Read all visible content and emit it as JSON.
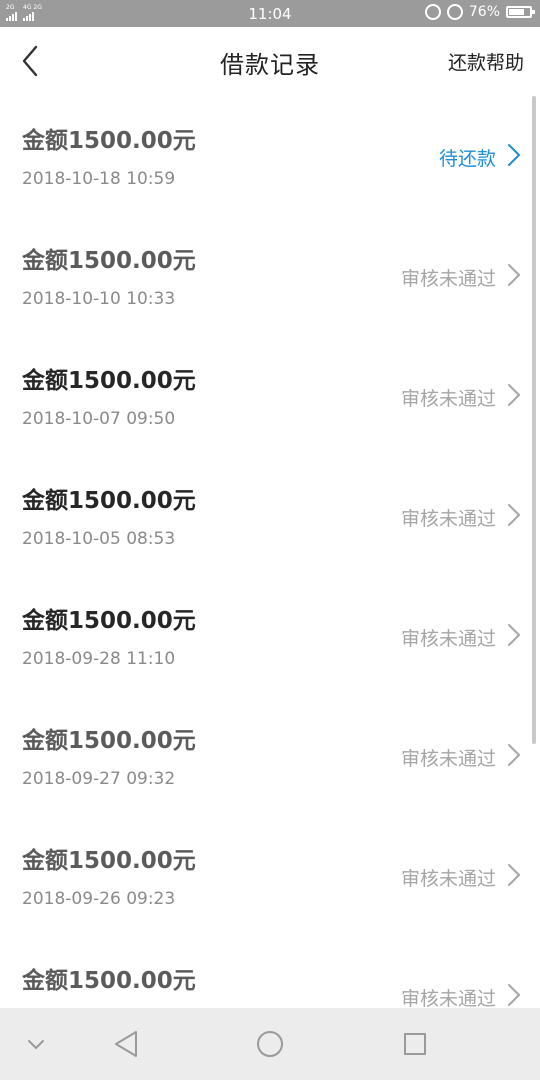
{
  "status_bar": {
    "left_sim1": "2G",
    "left_sim2": "4G 2G",
    "time": "11:04",
    "battery_percent": "76%",
    "battery_level": 0.76
  },
  "header": {
    "title": "借款记录",
    "help": "还款帮助"
  },
  "records": [
    {
      "amount": "金额1500.00元",
      "date": "2018-10-18 10:59",
      "status": "待还款",
      "status_type": "pending"
    },
    {
      "amount": "金额1500.00元",
      "date": "2018-10-10 10:33",
      "status": "审核未通过",
      "status_type": "rejected"
    },
    {
      "amount": "金额1500.00元",
      "date": "2018-10-07 09:50",
      "status": "审核未通过",
      "status_type": "rejected"
    },
    {
      "amount": "金额1500.00元",
      "date": "2018-10-05 08:53",
      "status": "审核未通过",
      "status_type": "rejected"
    },
    {
      "amount": "金额1500.00元",
      "date": "2018-09-28 11:10",
      "status": "审核未通过",
      "status_type": "rejected"
    },
    {
      "amount": "金额1500.00元",
      "date": "2018-09-27 09:32",
      "status": "审核未通过",
      "status_type": "rejected"
    },
    {
      "amount": "金额1500.00元",
      "date": "2018-09-26 09:23",
      "status": "审核未通过",
      "status_type": "rejected"
    },
    {
      "amount": "金额1500.00元",
      "date": "",
      "status": "审核未通过",
      "status_type": "rejected"
    }
  ],
  "colors": {
    "pending": "#1f8ed6",
    "rejected": "#a6a6a6",
    "status_bar": "#9b9b9b",
    "nav_bar": "#ececec"
  },
  "icons": {
    "back": "chevron-left-icon",
    "row_arrow": "chevron-right-icon",
    "nav_down": "chevron-down-icon",
    "nav_back": "triangle-back-icon",
    "nav_home": "circle-home-icon",
    "nav_recent": "square-recent-icon"
  }
}
